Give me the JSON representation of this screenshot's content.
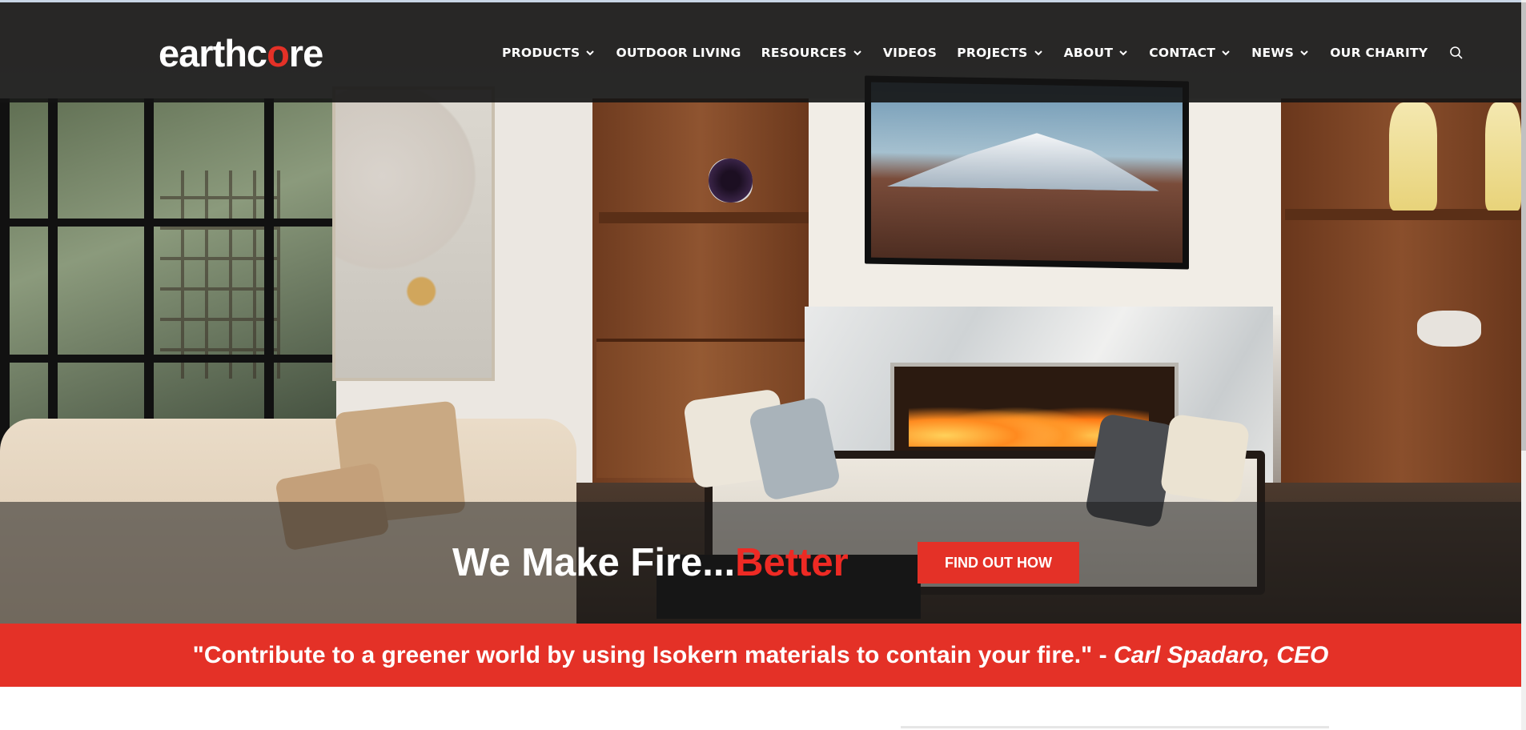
{
  "brand": {
    "logo_prefix": "earthc",
    "logo_o": "o",
    "logo_suffix": "re",
    "accent_color": "#e43127"
  },
  "nav": {
    "items": [
      {
        "label": "PRODUCTS",
        "has_dropdown": true
      },
      {
        "label": "OUTDOOR LIVING",
        "has_dropdown": false
      },
      {
        "label": "RESOURCES",
        "has_dropdown": true
      },
      {
        "label": "VIDEOS",
        "has_dropdown": false
      },
      {
        "label": "PROJECTS",
        "has_dropdown": true
      },
      {
        "label": "ABOUT",
        "has_dropdown": true
      },
      {
        "label": "CONTACT",
        "has_dropdown": true
      },
      {
        "label": "NEWS",
        "has_dropdown": true
      },
      {
        "label": "OUR CHARITY",
        "has_dropdown": false
      }
    ],
    "search_icon": "search-icon"
  },
  "hero": {
    "headline_main": "We Make Fire...",
    "headline_accent": "Better",
    "cta_label": "FIND OUT HOW"
  },
  "quote": {
    "text": "\"Contribute to a greener world by using Isokern materials to contain your fire.\" - ",
    "author": "Carl Spadaro, CEO"
  }
}
